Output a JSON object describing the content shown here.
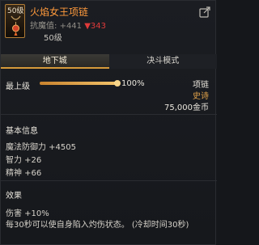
{
  "header": {
    "icon_level": "50级",
    "item_name": "火焰女王项链",
    "stat_label": "抗魔值: ",
    "stat_up": "+441",
    "stat_down": "▼343",
    "required_level": "50级"
  },
  "tabs": [
    {
      "label": "地下城",
      "active": true
    },
    {
      "label": "决斗模式",
      "active": false
    }
  ],
  "level_row": {
    "label": "最上级",
    "progress_fraction": 1.0,
    "progress_text": "100%"
  },
  "item_info": {
    "type": "项链",
    "rarity": "史诗",
    "price": "75,000金币"
  },
  "basic_info": {
    "title": "基本信息",
    "lines": [
      "魔法防御力 +4505",
      "智力 +26",
      "精神 +66"
    ]
  },
  "effects": {
    "title": "效果",
    "lines": [
      "伤害 +10%",
      "每30秒可以使自身陷入灼伤状态。 (冷却时间30秒)"
    ]
  },
  "colors": {
    "item_name": "#ff9a3c",
    "rarity": "#e0a24a",
    "stat_down": "#e03a3a",
    "tab_active_underline": "#d69a3a"
  },
  "icons": {
    "item_icon": "necklace-icon",
    "share": "share-icon"
  }
}
